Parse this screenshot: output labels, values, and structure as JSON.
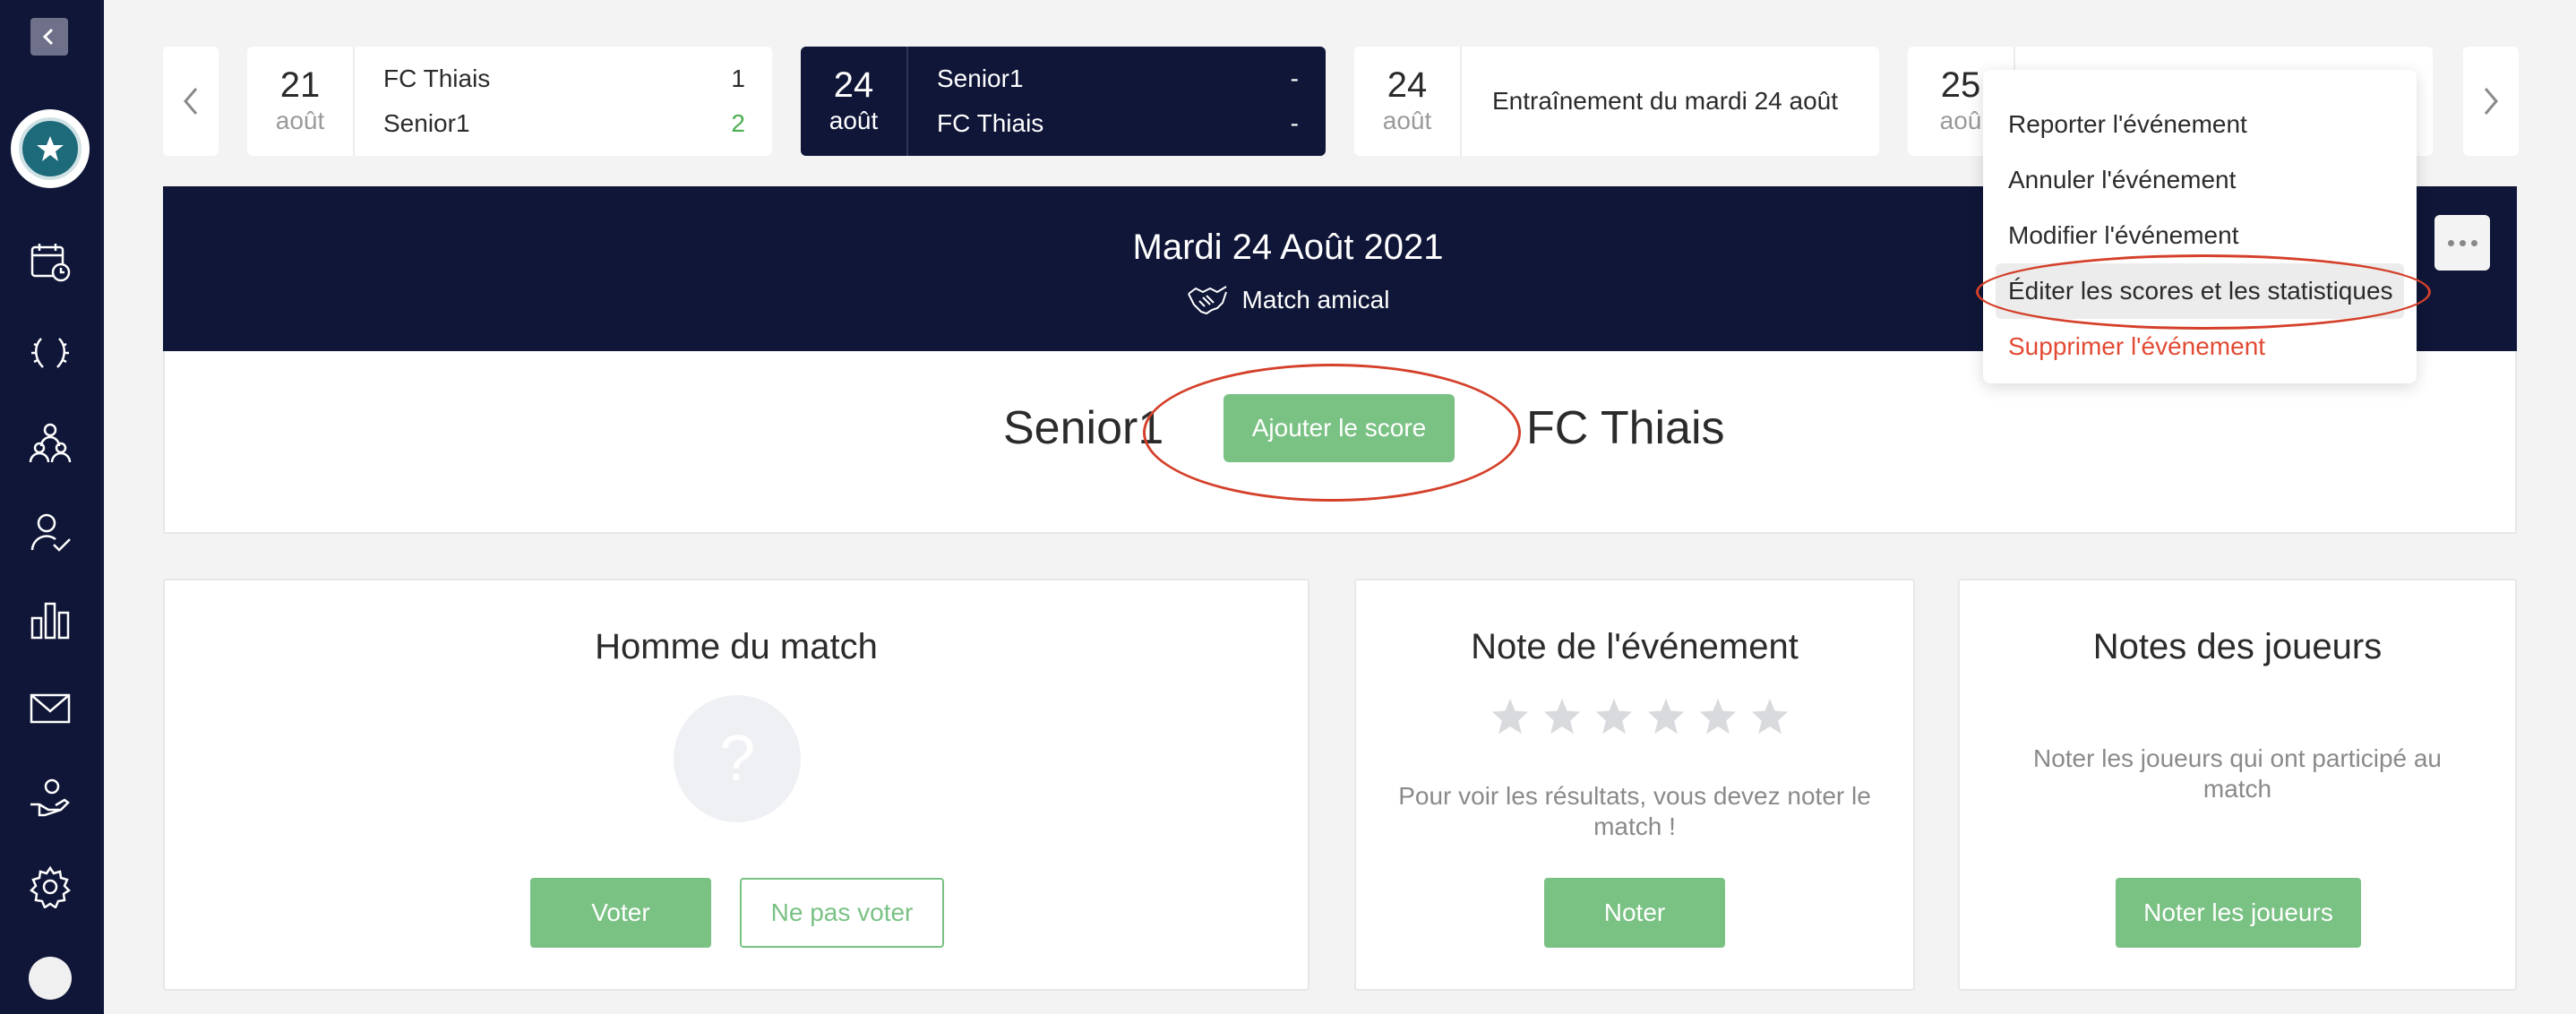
{
  "sidebar": {
    "items": [
      {
        "icon": "calendar-icon"
      },
      {
        "icon": "laurel-icon"
      },
      {
        "icon": "team-icon"
      },
      {
        "icon": "user-check-icon"
      },
      {
        "icon": "stats-icon"
      },
      {
        "icon": "mail-icon"
      },
      {
        "icon": "hand-icon"
      },
      {
        "icon": "gear-icon"
      }
    ]
  },
  "events": [
    {
      "day": "21",
      "month": "août",
      "team1": "FC Thiais",
      "score1": "1",
      "team2": "Senior1",
      "score2": "2"
    },
    {
      "day": "24",
      "month": "août",
      "team1": "Senior1",
      "score1": "-",
      "team2": "FC Thiais",
      "score2": "-"
    },
    {
      "day": "24",
      "month": "août",
      "title": "Entraînement du mardi 24 août"
    },
    {
      "day": "25",
      "month": "aoû"
    }
  ],
  "header": {
    "date": "Mardi 24 Août 2021",
    "type": "Match amical"
  },
  "match": {
    "home": "Senior1",
    "away": "FC Thiais",
    "add_score": "Ajouter le score"
  },
  "menu": {
    "items": [
      "Reporter l'événement",
      "Annuler l'événement",
      "Modifier l'événement",
      "Éditer les scores et les statistiques",
      "Supprimer l'événement"
    ]
  },
  "cards": {
    "motm": {
      "title": "Homme du match",
      "placeholder": "?",
      "vote": "Voter",
      "no_vote": "Ne pas voter"
    },
    "rating": {
      "title": "Note de l'événement",
      "text": "Pour voir les résultats, vous devez noter le match !",
      "button": "Noter",
      "stars_filled": 0,
      "stars_total": 6
    },
    "players": {
      "title": "Notes des joueurs",
      "text": "Noter les joueurs qui ont participé au match",
      "button": "Noter les joueurs"
    }
  },
  "colors": {
    "navy": "#0f1637",
    "green": "#7ac184",
    "danger": "#e24a35",
    "annotation": "#d4402a"
  }
}
